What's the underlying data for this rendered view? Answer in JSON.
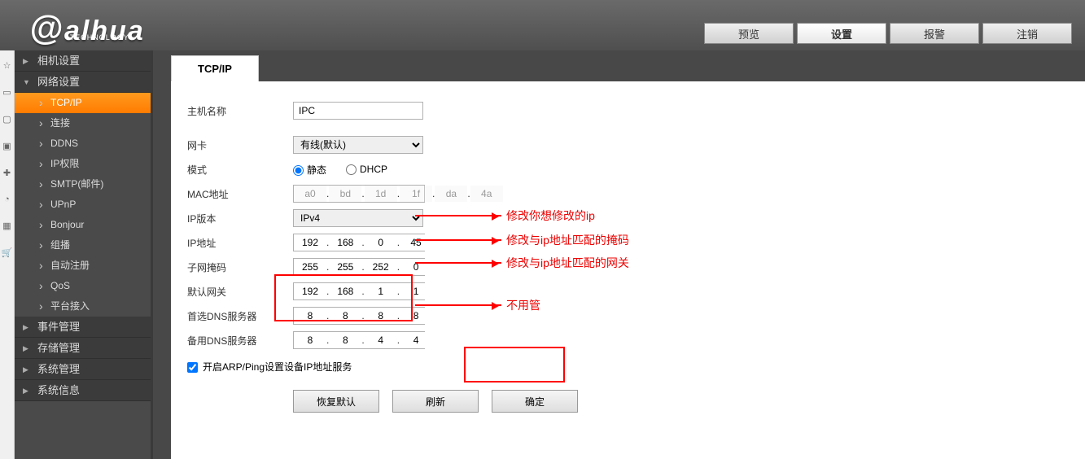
{
  "brand": {
    "name": "alhua",
    "sub": "TECHNOLOGY"
  },
  "topnav": [
    {
      "label": "预览",
      "active": false
    },
    {
      "label": "设置",
      "active": true
    },
    {
      "label": "报警",
      "active": false
    },
    {
      "label": "注销",
      "active": false
    }
  ],
  "sidebar": {
    "camera": "相机设置",
    "network": "网络设置",
    "net_items": [
      "TCP/IP",
      "连接",
      "DDNS",
      "IP权限",
      "SMTP(邮件)",
      "UPnP",
      "Bonjour",
      "组播",
      "自动注册",
      "QoS",
      "平台接入"
    ],
    "event": "事件管理",
    "storage": "存储管理",
    "system": "系统管理",
    "info": "系统信息"
  },
  "tab": "TCP/IP",
  "form": {
    "host_label": "主机名称",
    "host": "IPC",
    "nic_label": "网卡",
    "nic": "有线(默认)",
    "mode_label": "模式",
    "mode_static": "静态",
    "mode_dhcp": "DHCP",
    "mac_label": "MAC地址",
    "mac": [
      "a0",
      "bd",
      "1d",
      "1f",
      "da",
      "4a"
    ],
    "ipver_label": "IP版本",
    "ipver": "IPv4",
    "ip_label": "IP地址",
    "ip": [
      "192",
      "168",
      "0",
      "45"
    ],
    "mask_label": "子网掩码",
    "mask": [
      "255",
      "255",
      "252",
      "0"
    ],
    "gw_label": "默认网关",
    "gw": [
      "192",
      "168",
      "1",
      "1"
    ],
    "dns1_label": "首选DNS服务器",
    "dns1": [
      "8",
      "8",
      "8",
      "8"
    ],
    "dns2_label": "备用DNS服务器",
    "dns2": [
      "8",
      "8",
      "4",
      "4"
    ],
    "arp_label": "开启ARP/Ping设置设备IP地址服务",
    "btn_default": "恢复默认",
    "btn_refresh": "刷新",
    "btn_ok": "确定"
  },
  "annot": {
    "a1": "修改你想修改的ip",
    "a2": "修改与ip地址匹配的掩码",
    "a3": "修改与ip地址匹配的网关",
    "a4": "不用管"
  }
}
